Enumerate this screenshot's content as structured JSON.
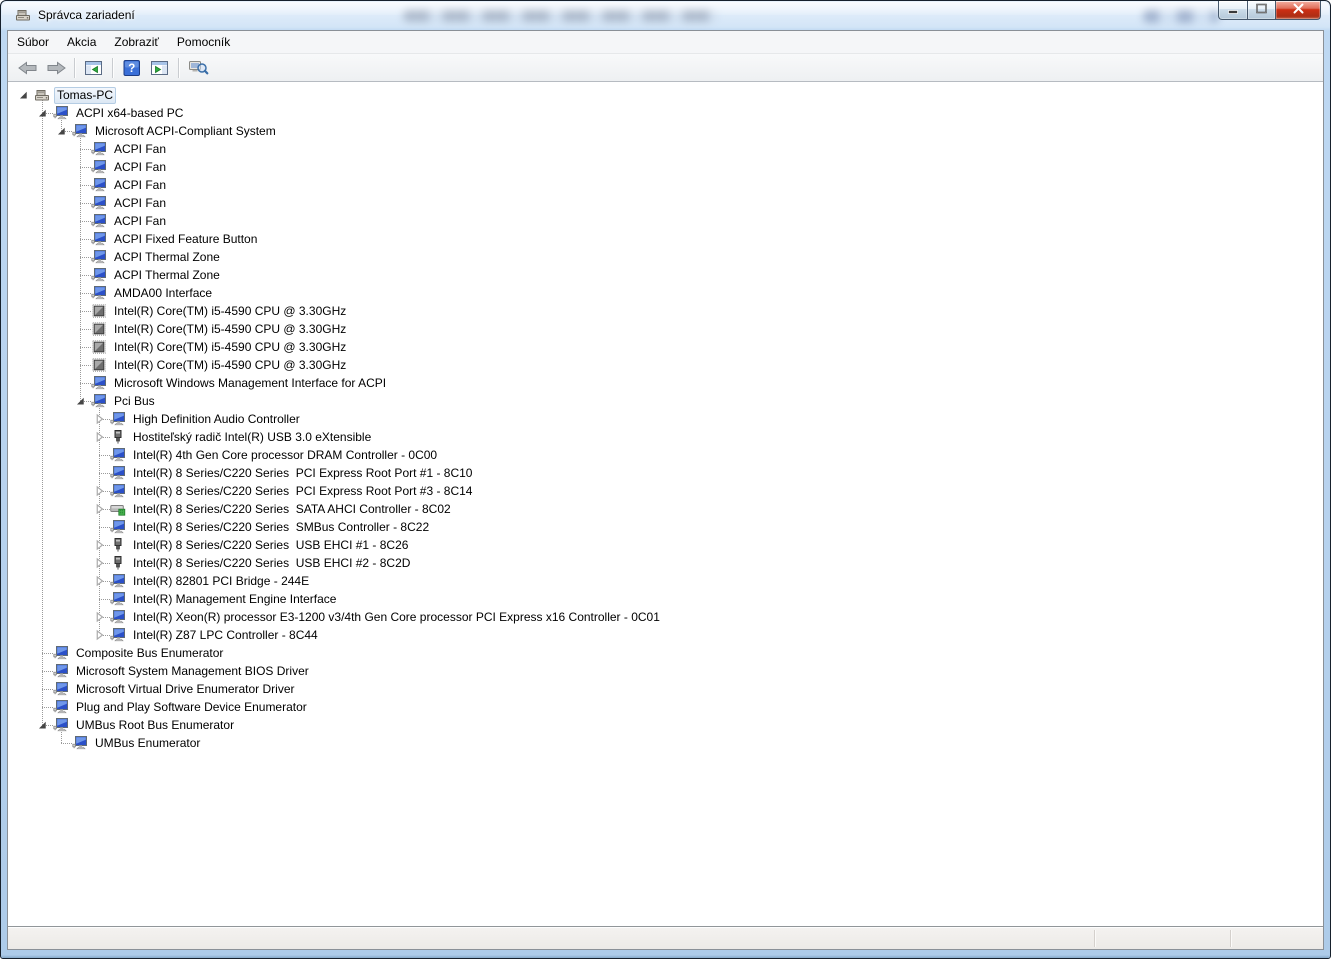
{
  "window": {
    "title": "Správca zariadení"
  },
  "titlebar": {
    "app_icon": "device-manager-icon",
    "controls": [
      {
        "name": "minimize-button",
        "icon": "minimize-icon"
      },
      {
        "name": "maximize-button",
        "icon": "maximize-icon"
      },
      {
        "name": "close-button",
        "icon": "close-icon"
      }
    ]
  },
  "menu": {
    "items": [
      "Súbor",
      "Akcia",
      "Zobraziť",
      "Pomocník"
    ]
  },
  "toolbar": {
    "buttons": [
      {
        "name": "back-button",
        "icon": "back-icon"
      },
      {
        "name": "forward-button",
        "icon": "forward-icon"
      },
      {
        "name": "separator"
      },
      {
        "name": "console-tree-toggle-button",
        "icon": "console-tree-icon"
      },
      {
        "name": "separator"
      },
      {
        "name": "help-button",
        "icon": "help-icon"
      },
      {
        "name": "action-pane-toggle-button",
        "icon": "action-pane-icon"
      },
      {
        "name": "separator"
      },
      {
        "name": "scan-hardware-changes-button",
        "icon": "scan-hardware-icon"
      }
    ]
  },
  "tree": {
    "rows": [
      {
        "label": "Tomas-PC",
        "level": 0,
        "expander": "expanded",
        "icon": "computer-icon",
        "selected": true
      },
      {
        "label": "ACPI x64-based PC",
        "level": 1,
        "expander": "expanded",
        "icon": "system-device-icon"
      },
      {
        "label": "Microsoft ACPI-Compliant System",
        "level": 2,
        "expander": "expanded",
        "icon": "system-device-icon"
      },
      {
        "label": "ACPI Fan",
        "level": 3,
        "expander": "none",
        "icon": "system-device-icon"
      },
      {
        "label": "ACPI Fan",
        "level": 3,
        "expander": "none",
        "icon": "system-device-icon"
      },
      {
        "label": "ACPI Fan",
        "level": 3,
        "expander": "none",
        "icon": "system-device-icon"
      },
      {
        "label": "ACPI Fan",
        "level": 3,
        "expander": "none",
        "icon": "system-device-icon"
      },
      {
        "label": "ACPI Fan",
        "level": 3,
        "expander": "none",
        "icon": "system-device-icon"
      },
      {
        "label": "ACPI Fixed Feature Button",
        "level": 3,
        "expander": "none",
        "icon": "system-device-icon"
      },
      {
        "label": "ACPI Thermal Zone",
        "level": 3,
        "expander": "none",
        "icon": "system-device-icon"
      },
      {
        "label": "ACPI Thermal Zone",
        "level": 3,
        "expander": "none",
        "icon": "system-device-icon"
      },
      {
        "label": "AMDA00 Interface",
        "level": 3,
        "expander": "none",
        "icon": "system-device-icon"
      },
      {
        "label": "Intel(R) Core(TM) i5-4590 CPU @ 3.30GHz",
        "level": 3,
        "expander": "none",
        "icon": "cpu-icon"
      },
      {
        "label": "Intel(R) Core(TM) i5-4590 CPU @ 3.30GHz",
        "level": 3,
        "expander": "none",
        "icon": "cpu-icon"
      },
      {
        "label": "Intel(R) Core(TM) i5-4590 CPU @ 3.30GHz",
        "level": 3,
        "expander": "none",
        "icon": "cpu-icon"
      },
      {
        "label": "Intel(R) Core(TM) i5-4590 CPU @ 3.30GHz",
        "level": 3,
        "expander": "none",
        "icon": "cpu-icon"
      },
      {
        "label": "Microsoft Windows Management Interface for ACPI",
        "level": 3,
        "expander": "none",
        "icon": "system-device-icon"
      },
      {
        "label": "Pci Bus",
        "level": 3,
        "expander": "expanded",
        "icon": "system-device-icon"
      },
      {
        "label": "High Definition Audio Controller",
        "level": 4,
        "expander": "collapsed",
        "icon": "system-device-icon"
      },
      {
        "label": "Hostiteľský radič Intel(R) USB 3.0 eXtensible",
        "level": 4,
        "expander": "collapsed",
        "icon": "usb-icon"
      },
      {
        "label": "Intel(R) 4th Gen Core processor DRAM Controller - 0C00",
        "level": 4,
        "expander": "none",
        "icon": "system-device-icon"
      },
      {
        "label": "Intel(R) 8 Series/C220 Series  PCI Express Root Port #1 - 8C10",
        "level": 4,
        "expander": "none",
        "icon": "system-device-icon"
      },
      {
        "label": "Intel(R) 8 Series/C220 Series  PCI Express Root Port #3 - 8C14",
        "level": 4,
        "expander": "collapsed",
        "icon": "system-device-icon"
      },
      {
        "label": "Intel(R) 8 Series/C220 Series  SATA AHCI Controller - 8C02",
        "level": 4,
        "expander": "collapsed",
        "icon": "disk-icon"
      },
      {
        "label": "Intel(R) 8 Series/C220 Series  SMBus Controller - 8C22",
        "level": 4,
        "expander": "none",
        "icon": "system-device-icon"
      },
      {
        "label": "Intel(R) 8 Series/C220 Series  USB EHCI #1 - 8C26",
        "level": 4,
        "expander": "collapsed",
        "icon": "usb-icon"
      },
      {
        "label": "Intel(R) 8 Series/C220 Series  USB EHCI #2 - 8C2D",
        "level": 4,
        "expander": "collapsed",
        "icon": "usb-icon"
      },
      {
        "label": "Intel(R) 82801 PCI Bridge - 244E",
        "level": 4,
        "expander": "collapsed",
        "icon": "system-device-icon"
      },
      {
        "label": "Intel(R) Management Engine Interface",
        "level": 4,
        "expander": "none",
        "icon": "system-device-icon"
      },
      {
        "label": "Intel(R) Xeon(R) processor E3-1200 v3/4th Gen Core processor PCI Express x16 Controller - 0C01",
        "level": 4,
        "expander": "collapsed",
        "icon": "system-device-icon"
      },
      {
        "label": "Intel(R) Z87 LPC Controller - 8C44",
        "level": 4,
        "expander": "collapsed",
        "icon": "system-device-icon"
      },
      {
        "label": "Composite Bus Enumerator",
        "level": 1,
        "expander": "none",
        "icon": "system-device-icon"
      },
      {
        "label": "Microsoft System Management BIOS Driver",
        "level": 1,
        "expander": "none",
        "icon": "system-device-icon"
      },
      {
        "label": "Microsoft Virtual Drive Enumerator Driver",
        "level": 1,
        "expander": "none",
        "icon": "system-device-icon"
      },
      {
        "label": "Plug and Play Software Device Enumerator",
        "level": 1,
        "expander": "none",
        "icon": "system-device-icon"
      },
      {
        "label": "UMBus Root Bus Enumerator",
        "level": 1,
        "expander": "expanded",
        "icon": "system-device-icon"
      },
      {
        "label": "UMBus Enumerator",
        "level": 2,
        "expander": "none",
        "icon": "system-device-icon"
      }
    ]
  },
  "status_bar": {
    "text": ""
  },
  "colors": {
    "titlebar_top": "#e9f2fc",
    "titlebar_bottom": "#b7d2ee",
    "selection_border": "#b5cde4",
    "close_button_red": "#cd2f14",
    "tree_guide": "#9a9a9a",
    "screen_blue": "#2b50c8"
  }
}
